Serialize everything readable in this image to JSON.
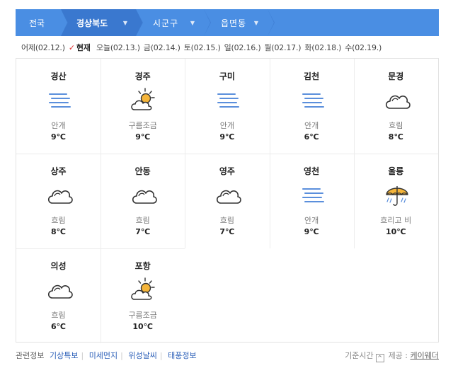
{
  "breadcrumb": {
    "items": [
      {
        "label": "전국"
      },
      {
        "label": "경상북도"
      },
      {
        "label": "시군구"
      },
      {
        "label": "읍면동"
      }
    ],
    "caret": "▼"
  },
  "days": {
    "yesterday": "어제(02.12.)",
    "check": "✓",
    "current": "현재",
    "items": [
      "오늘(02.13.)",
      "금(02.14.)",
      "토(02.15.)",
      "일(02.16.)",
      "월(02.17.)",
      "화(02.18.)",
      "수(02.19.)"
    ]
  },
  "cities": [
    {
      "name": "경산",
      "condition": "안개",
      "temp": "9℃",
      "icon": "fog-icon"
    },
    {
      "name": "경주",
      "condition": "구름조금",
      "temp": "9℃",
      "icon": "partly-cloudy-icon"
    },
    {
      "name": "구미",
      "condition": "안개",
      "temp": "9℃",
      "icon": "fog-icon"
    },
    {
      "name": "김천",
      "condition": "안개",
      "temp": "6℃",
      "icon": "fog-icon"
    },
    {
      "name": "문경",
      "condition": "흐림",
      "temp": "8℃",
      "icon": "cloud-icon"
    },
    {
      "name": "상주",
      "condition": "흐림",
      "temp": "8℃",
      "icon": "cloud-icon"
    },
    {
      "name": "안동",
      "condition": "흐림",
      "temp": "7℃",
      "icon": "cloud-icon"
    },
    {
      "name": "영주",
      "condition": "흐림",
      "temp": "7℃",
      "icon": "cloud-icon"
    },
    {
      "name": "영천",
      "condition": "안개",
      "temp": "9℃",
      "icon": "fog-icon"
    },
    {
      "name": "울릉",
      "condition": "흐리고 비",
      "temp": "10℃",
      "icon": "umbrella-rain-icon"
    },
    {
      "name": "의성",
      "condition": "흐림",
      "temp": "6℃",
      "icon": "cloud-icon"
    },
    {
      "name": "포항",
      "condition": "구름조금",
      "temp": "10℃",
      "icon": "partly-cloudy-icon"
    }
  ],
  "footer": {
    "label": "관련정보",
    "links": [
      "기상특보",
      "미세먼지",
      "위성날씨",
      "태풍정보"
    ],
    "standard_time": "기준시간",
    "toggle": "^",
    "provider_label": "제공 :",
    "provider": "케이웨더"
  },
  "colors": {
    "breadcrumb_bg": "#4a8ee3",
    "link": "#2b5fb8",
    "check": "#e03333",
    "fog": "#5b8fdc",
    "sun": "#f5b53a"
  }
}
